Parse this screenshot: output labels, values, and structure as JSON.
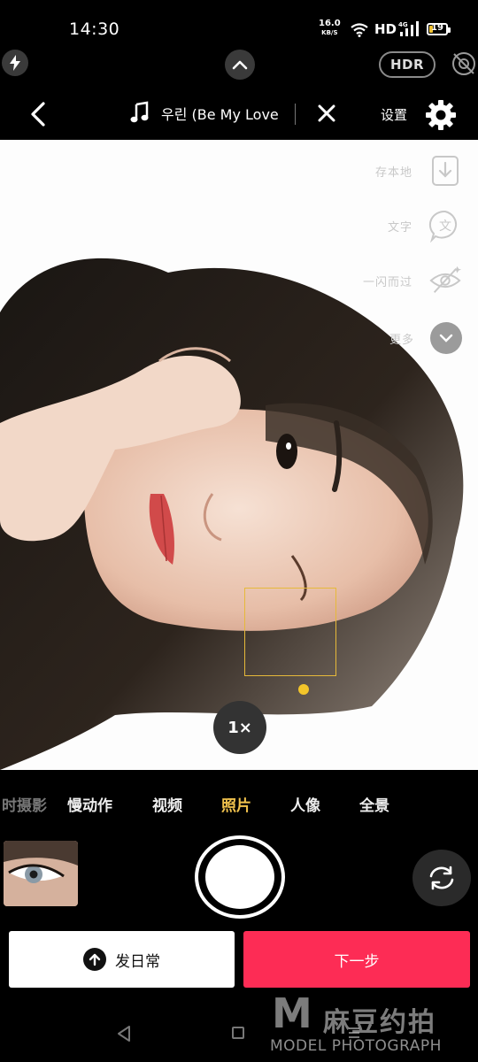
{
  "status_bar": {
    "time": "14:30",
    "net_speed": "16.0",
    "net_unit": "KB/S",
    "hd_label": "HD",
    "signal_label": "4G",
    "battery": "19",
    "battery_color": "#f2c331"
  },
  "camera_controls": {
    "flash_icon": "flash-auto-icon",
    "collapse_icon": "chevron-up-icon",
    "hdr_label": "HDR",
    "eye_icon": "eye-off-icon"
  },
  "header": {
    "back_icon": "chevron-left-icon",
    "music_icon": "music-note-icon",
    "song_title": "우린 (Be My Love)-E",
    "remove_music_icon": "close-icon",
    "settings_label": "设置",
    "settings_icon": "gear-icon"
  },
  "side_tools": [
    {
      "label": "存本地",
      "icon": "download-icon"
    },
    {
      "label": "文字",
      "icon": "text-icon"
    },
    {
      "label": "一闪而过",
      "icon": "eye-flash-icon"
    },
    {
      "label": "更多",
      "icon": "chevron-down-icon"
    }
  ],
  "viewfinder": {
    "zoom_label": "1×",
    "focus_color": "#e6b93a"
  },
  "modes": {
    "items": [
      "时摄影",
      "慢动作",
      "视频",
      "照片",
      "人像",
      "全景"
    ],
    "active": "照片",
    "active_color": "#f1c24d"
  },
  "capture": {
    "shutter_icon": "shutter-button",
    "flip_icon": "camera-flip-icon"
  },
  "actions": {
    "post_label": "发日常",
    "post_icon": "arrow-up-icon",
    "next_label": "下一步",
    "next_color": "#fd2c55"
  },
  "watermark": {
    "logo": "M",
    "cn": "麻豆约拍",
    "en": "MODEL PHOTOGRAPH"
  }
}
